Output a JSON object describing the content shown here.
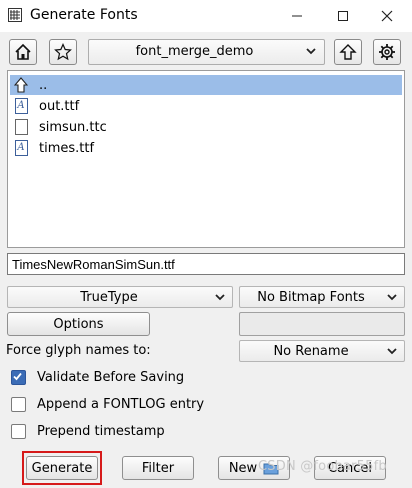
{
  "window": {
    "title": "Generate Fonts"
  },
  "toolbar": {
    "directory": "font_merge_demo"
  },
  "files": [
    {
      "name": "..",
      "icon": "up-arrow-icon"
    },
    {
      "name": "out.ttf",
      "icon": "font-file-icon"
    },
    {
      "name": "simsun.ttc",
      "icon": "blank-file-icon"
    },
    {
      "name": "times.ttf",
      "icon": "font-file-icon"
    }
  ],
  "filename": {
    "value": "TimesNewRomanSimSun.ttf"
  },
  "format": {
    "selected": "TrueType"
  },
  "bitmap": {
    "selected": "No Bitmap Fonts"
  },
  "options": {
    "label": "Options"
  },
  "glyph_names": {
    "label": "Force glyph names to:",
    "selected": "No Rename"
  },
  "checks": [
    {
      "label": "Validate Before Saving",
      "checked": true
    },
    {
      "label": "Append a FONTLOG entry",
      "checked": false
    },
    {
      "label": "Prepend timestamp",
      "checked": false
    }
  ],
  "buttons": {
    "generate": "Generate",
    "filter": "Filter",
    "new": "New",
    "cancel": "Cancel"
  },
  "watermark": "CSDN @foobar55fb",
  "colors": {
    "selection": "#9bbde8",
    "highlight_border": "#d61a1a",
    "checkbox_on": "#3b6cb6"
  }
}
